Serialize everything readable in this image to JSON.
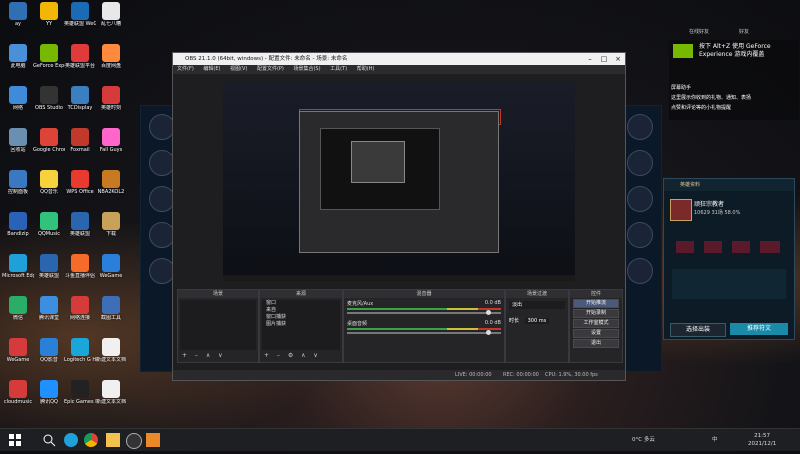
{
  "desktop_icons": [
    {
      "label": "ay",
      "color": "#2f6fb3",
      "col": 0,
      "row": 0
    },
    {
      "label": "YY",
      "color": "#f2b705",
      "col": 1,
      "row": 0
    },
    {
      "label": "英雄联盟 WeGame",
      "color": "#1b6ab5",
      "col": 2,
      "row": 0
    },
    {
      "label": "乱七八糟",
      "color": "#e8e8e8",
      "col": 3,
      "row": 0
    },
    {
      "label": "此电脑",
      "color": "#4a90d9",
      "col": 0,
      "row": 1
    },
    {
      "label": "GeForce Experience",
      "color": "#76b900",
      "col": 1,
      "row": 1
    },
    {
      "label": "英雄联盟平台",
      "color": "#e03a3a",
      "col": 2,
      "row": 1
    },
    {
      "label": "百度网盘",
      "color": "#ff8a3d",
      "col": 3,
      "row": 1
    },
    {
      "label": "网络",
      "color": "#3d8bd9",
      "col": 0,
      "row": 2
    },
    {
      "label": "OBS Studio",
      "color": "#333333",
      "col": 1,
      "row": 2
    },
    {
      "label": "TCDisplay",
      "color": "#3a7fc0",
      "col": 2,
      "row": 2
    },
    {
      "label": "英雄时刻",
      "color": "#d63b3b",
      "col": 3,
      "row": 2
    },
    {
      "label": "回收站",
      "color": "#6a8fb0",
      "col": 0,
      "row": 3
    },
    {
      "label": "Google Chrome",
      "color": "#db4437",
      "col": 1,
      "row": 3
    },
    {
      "label": "Foxmail",
      "color": "#c0392b",
      "col": 2,
      "row": 3
    },
    {
      "label": "Fall Guys",
      "color": "#ff66cc",
      "col": 3,
      "row": 3
    },
    {
      "label": "控制面板",
      "color": "#3a78c2",
      "col": 0,
      "row": 4
    },
    {
      "label": "QQ音乐",
      "color": "#f7d23c",
      "col": 1,
      "row": 4
    },
    {
      "label": "WPS Office",
      "color": "#e83a2e",
      "col": 2,
      "row": 4
    },
    {
      "label": "NBA2KOL2",
      "color": "#c87a22",
      "col": 3,
      "row": 4
    },
    {
      "label": "Bandizip",
      "color": "#2a62b8",
      "col": 0,
      "row": 5
    },
    {
      "label": "QQMusic",
      "color": "#31c27c",
      "col": 1,
      "row": 5
    },
    {
      "label": "英雄联盟",
      "color": "#2a66b0",
      "col": 2,
      "row": 5
    },
    {
      "label": "下载",
      "color": "#c9a25a",
      "col": 3,
      "row": 5
    },
    {
      "label": "Microsoft Edge",
      "color": "#1fa0d8",
      "col": 0,
      "row": 6
    },
    {
      "label": "英雄联盟",
      "color": "#2a66b0",
      "col": 1,
      "row": 6
    },
    {
      "label": "斗鱼直播伴侣",
      "color": "#f46b2a",
      "col": 2,
      "row": 6
    },
    {
      "label": "WeGame",
      "color": "#2a7fd8",
      "col": 3,
      "row": 6
    },
    {
      "label": "微信",
      "color": "#2aae67",
      "col": 0,
      "row": 7
    },
    {
      "label": "腾讯课堂",
      "color": "#3b8ee0",
      "col": 1,
      "row": 7
    },
    {
      "label": "网络连接",
      "color": "#d63b3b",
      "col": 2,
      "row": 7
    },
    {
      "label": "截图工具",
      "color": "#3d6fb8",
      "col": 3,
      "row": 7
    },
    {
      "label": "WeGame",
      "color": "#d63b3b",
      "col": 0,
      "row": 8
    },
    {
      "label": "QQ影音",
      "color": "#2a7fd8",
      "col": 1,
      "row": 8
    },
    {
      "label": "Logitech G HUB",
      "color": "#1aa6d8",
      "col": 2,
      "row": 8
    },
    {
      "label": "新建文本文档",
      "color": "#f0f0f0",
      "col": 3,
      "row": 8
    },
    {
      "label": "cloudmusic",
      "color": "#d63b3b",
      "col": 0,
      "row": 9
    },
    {
      "label": "腾讯QQ",
      "color": "#1e90ff",
      "col": 1,
      "row": 9
    },
    {
      "label": "Epic Games Launcher",
      "color": "#222222",
      "col": 2,
      "row": 9
    },
    {
      "label": "新建文本文档",
      "color": "#f0f0f0",
      "col": 3,
      "row": 9
    }
  ],
  "obs": {
    "title": "OBS 21.1.0 (64bit, windows) - 配置文件: 未命名 - 场景: 未命名",
    "menu": [
      "文件(F)",
      "编辑(E)",
      "视图(V)",
      "配置文件(P)",
      "场景集合(S)",
      "工具(T)",
      "帮助(H)"
    ],
    "docks": {
      "scenes": {
        "title": "场景"
      },
      "sources": {
        "title": "来源",
        "items": [
          "窗口",
          "来自",
          "窗口捕获",
          "图片捕获"
        ]
      },
      "mixer": {
        "title": "混音器",
        "ch1": "麦克风/Aux",
        "ch1_db": "0.0 dB",
        "ch2": "桌面音频",
        "ch2_db": "0.0 dB"
      },
      "transitions": {
        "title": "场景过渡",
        "mode": "淡出",
        "duration_label": "时长",
        "duration": "300 ms"
      },
      "controls": {
        "title": "控件",
        "buttons": [
          "开始推流",
          "开始录制",
          "工作室模式",
          "设置",
          "退出"
        ]
      }
    },
    "status": {
      "live": "LIVE: 00:00:00",
      "rec": "REC: 00:00:00",
      "cpu": "CPU: 1.9%, 30.00 fps"
    }
  },
  "notification": {
    "header": "屏幕助手",
    "line1": "按下 Alt+Z 使用 GeForce Experience 游戏内覆盖",
    "line2": "这里展示你收到的礼物、通知、表扬",
    "line3": "点赞和评论等的小礼物提醒"
  },
  "rpanel": {
    "title": "英雄资料",
    "name": "顽狂宗教者",
    "stats": "10629  31场  58.0%",
    "btn_left": "选择出装",
    "btn_right": "推荐符文",
    "accent": "#1a8aa8"
  },
  "taskbar": {
    "weather": "0°C 多云",
    "time": "21:57",
    "date": "2021/12/1",
    "lang": "中"
  },
  "topright": {
    "labels": [
      "在线好友",
      "好友"
    ]
  }
}
